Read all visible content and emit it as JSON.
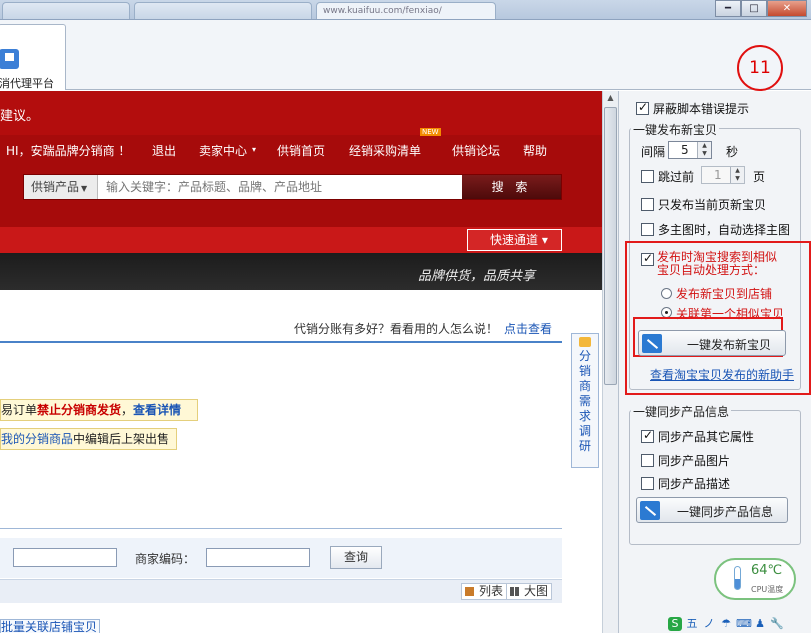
{
  "browser": {
    "tabs": [
      "",
      "",
      "www.kuaifuu.com/fenxiao/"
    ],
    "window_buttons": {
      "minimize": "━",
      "maximize": "□",
      "close": "✕"
    }
  },
  "agent_tab": {
    "label": "消代理平台",
    "icon": "flag-icon"
  },
  "badge": "11",
  "page": {
    "advice_text": "建议。",
    "nav": [
      "HI，安踹品牌分销商 ！",
      "退出",
      "卖家中心",
      "供销首页",
      "经销采购清单",
      "供销论坛",
      "帮助"
    ],
    "new_tag": "NEW",
    "search": {
      "category": "供销产品",
      "placeholder": "输入关键字：产品标题、品牌、产品地址",
      "button": "搜 索"
    },
    "quick_channel": "快速通道",
    "slogan": "品牌供货，品质共享",
    "promo_text": "代销分账有多好？看看用的人怎么说！",
    "promo_link": "点击查看",
    "notice1": {
      "prefix": "易订单",
      "emphasis": "禁止分销商发货",
      "sep": "，",
      "link": "查看详情"
    },
    "notice2": {
      "link": "我的分销商品",
      "suffix": "中编辑后上架出售"
    },
    "survey": [
      "分",
      "销",
      "商",
      "需",
      "求",
      "调",
      "研"
    ],
    "filter": {
      "merchant_code_label": "商家编码：",
      "query_button": "查询"
    },
    "view": {
      "list": "列表",
      "grid": "大图"
    },
    "bulk_link": "批量关联店铺宝贝"
  },
  "panel": {
    "block_script_errors": "屏蔽脚本错误提示",
    "publish_group": {
      "title": "一键发布新宝贝",
      "interval_label": "间隔",
      "interval_value": "5",
      "interval_unit": "秒",
      "skip_label": "跳过前",
      "skip_value": "1",
      "skip_unit": "页",
      "only_current": "只发布当前页新宝贝",
      "auto_main_image": "多主图时，自动选择主图",
      "similar_search": "发布时淘宝搜索到相似宝贝自动处理方式：",
      "radio_publish": "发布新宝贝到店铺",
      "radio_link": "关联第一个相似宝贝",
      "publish_button": "一键发布新宝贝",
      "view_link": "查看淘宝宝贝发布的新助手"
    },
    "sync_group": {
      "title": "一键同步产品信息",
      "sync_other": "同步产品其它属性",
      "sync_images": "同步产品图片",
      "sync_desc": "同步产品描述",
      "sync_button": "一键同步产品信息"
    },
    "cpu": {
      "temp": "64℃",
      "label": "CPU温度"
    },
    "tray_icons": [
      "S",
      "五",
      "ノ",
      "☂",
      "⌨",
      "♟",
      "🔧"
    ]
  },
  "colors": {
    "brand_red": "#a60b0b",
    "link_blue": "#1a55b5",
    "annotation_red": "#e21a1a"
  }
}
